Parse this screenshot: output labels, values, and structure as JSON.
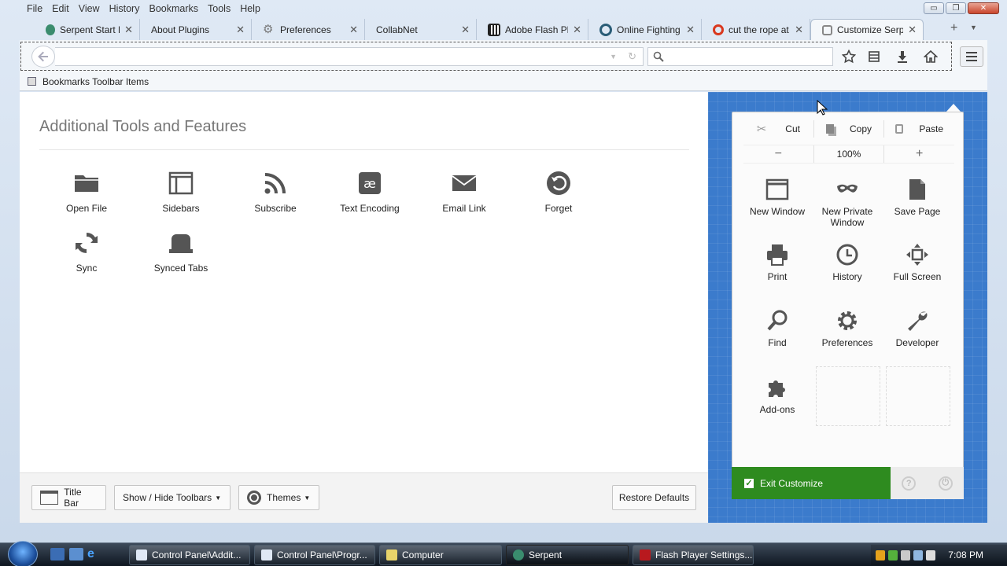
{
  "menubar": {
    "items": [
      "File",
      "Edit",
      "View",
      "History",
      "Bookmarks",
      "Tools",
      "Help"
    ]
  },
  "window_controls": {
    "minimize": "▭",
    "maximize": "❐",
    "close": "✕"
  },
  "tabs": [
    {
      "label": "Serpent Start Pa",
      "icon": "serpent-icon",
      "color": "#3a8c6e"
    },
    {
      "label": "About Plugins",
      "icon": "blank-page-icon",
      "color": "#f4f7fa"
    },
    {
      "label": "Preferences",
      "icon": "gear-icon",
      "color": "#777"
    },
    {
      "label": "CollabNet",
      "icon": "blank-page-icon",
      "color": "#f4f7fa"
    },
    {
      "label": "Adobe Flash Pla",
      "icon": "library-icon",
      "color": "#222"
    },
    {
      "label": "Online Fighting",
      "icon": "circle-c-icon",
      "color": "#2a5d77"
    },
    {
      "label": "cut the rope at",
      "icon": "opera-icon",
      "color": "#d9381e"
    },
    {
      "label": "Customize Serp",
      "icon": "customize-icon",
      "color": "#888",
      "active": true
    }
  ],
  "new_tab": "+",
  "navbar": {
    "url_value": "",
    "search_placeholder": ""
  },
  "bookmarks_toolbar": {
    "label": "Bookmarks Toolbar Items"
  },
  "palette": {
    "title": "Additional Tools and Features",
    "items": [
      {
        "label": "Open File",
        "icon": "folder-icon"
      },
      {
        "label": "Sidebars",
        "icon": "sidebar-icon"
      },
      {
        "label": "Subscribe",
        "icon": "rss-icon"
      },
      {
        "label": "Text Encoding",
        "icon": "text-encoding-icon"
      },
      {
        "label": "Email Link",
        "icon": "email-icon"
      },
      {
        "label": "Forget",
        "icon": "forget-icon"
      },
      {
        "label": "Sync",
        "icon": "sync-icon"
      },
      {
        "label": "Synced Tabs",
        "icon": "synced-tabs-icon"
      }
    ]
  },
  "footer": {
    "title_bar": "Title Bar",
    "show_hide": "Show / Hide Toolbars",
    "themes": "Themes",
    "restore": "Restore Defaults"
  },
  "menu_panel": {
    "edit": {
      "cut": "Cut",
      "copy": "Copy",
      "paste": "Paste"
    },
    "zoom": {
      "minus": "−",
      "level": "100%",
      "plus": "+"
    },
    "items": [
      {
        "label": "New Window",
        "icon": "new-window-icon"
      },
      {
        "label": "New Private Window",
        "icon": "private-mask-icon"
      },
      {
        "label": "Save Page",
        "icon": "save-page-icon"
      },
      {
        "label": "Print",
        "icon": "print-icon"
      },
      {
        "label": "History",
        "icon": "history-clock-icon"
      },
      {
        "label": "Full Screen",
        "icon": "fullscreen-icon"
      },
      {
        "label": "Find",
        "icon": "find-magnifier-icon"
      },
      {
        "label": "Preferences",
        "icon": "gear-icon"
      },
      {
        "label": "Developer",
        "icon": "wrench-icon"
      },
      {
        "label": "Add-ons",
        "icon": "puzzle-icon"
      }
    ],
    "exit_customize": "Exit Customize",
    "exit_checked": true,
    "help": "?"
  },
  "taskbar": {
    "tasks": [
      {
        "label": "Control Panel\\Addit...",
        "color": "#dfe8f5"
      },
      {
        "label": "Control Panel\\Progr...",
        "color": "#dfe8f5"
      },
      {
        "label": "Computer",
        "color": "#e9d46a"
      },
      {
        "label": "Serpent",
        "color": "#3a8c6e",
        "active": true
      },
      {
        "label": "Flash Player Settings...",
        "color": "#b8191e"
      }
    ],
    "clock": "7:08 PM"
  }
}
